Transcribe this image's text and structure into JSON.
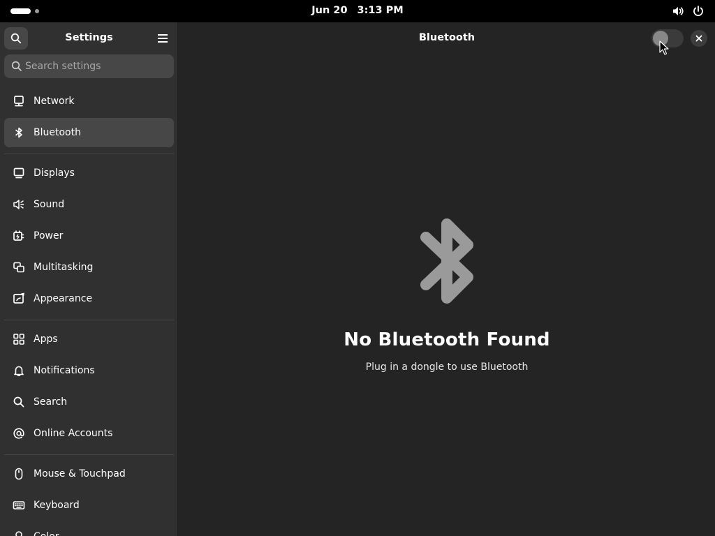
{
  "topbar": {
    "date": "Jun 20",
    "time": "3:13 PM"
  },
  "sidebar": {
    "title": "Settings",
    "search_placeholder": "Search settings",
    "items": [
      {
        "label": "Network",
        "icon": "network-icon"
      },
      {
        "label": "Bluetooth",
        "icon": "bluetooth-icon",
        "active": true
      },
      {
        "label": "Displays",
        "icon": "display-icon"
      },
      {
        "label": "Sound",
        "icon": "sound-icon"
      },
      {
        "label": "Power",
        "icon": "power-icon"
      },
      {
        "label": "Multitasking",
        "icon": "multitasking-icon"
      },
      {
        "label": "Appearance",
        "icon": "appearance-icon"
      },
      {
        "label": "Apps",
        "icon": "apps-icon"
      },
      {
        "label": "Notifications",
        "icon": "bell-icon"
      },
      {
        "label": "Search",
        "icon": "search-icon"
      },
      {
        "label": "Online Accounts",
        "icon": "at-icon"
      },
      {
        "label": "Mouse & Touchpad",
        "icon": "mouse-icon"
      },
      {
        "label": "Keyboard",
        "icon": "keyboard-icon"
      },
      {
        "label": "Color",
        "icon": "color-icon"
      }
    ]
  },
  "main": {
    "title": "Bluetooth",
    "toggle_on": false,
    "empty_title": "No Bluetooth Found",
    "empty_subtitle": "Plug in a dongle to use Bluetooth"
  },
  "colors": {
    "sidebar_bg": "#303030",
    "content_bg": "#242424",
    "active_item_bg": "#474747",
    "topbar_bg": "#000000",
    "empty_icon": "#9a9a9a"
  }
}
